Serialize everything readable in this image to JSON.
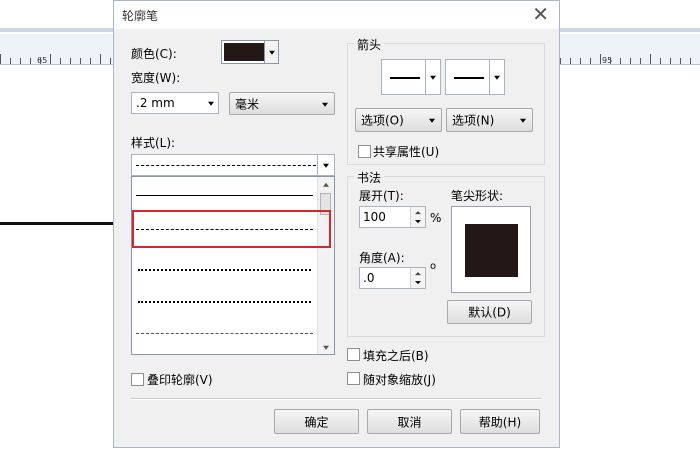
{
  "ruler": {
    "labels": [
      "65",
      "95"
    ]
  },
  "dialog": {
    "title": "轮廓笔",
    "close_glyph": "✕",
    "color_label": "颜色(C):",
    "color_value": "#231816",
    "width_label": "宽度(W):",
    "width_value": ".2 mm",
    "unit_value": "毫米",
    "style_label": "样式(L):",
    "overprint_label": "叠印轮廓(V)",
    "arrows": {
      "group_title": "箭头",
      "options_left": "选项(O)",
      "options_right": "选项(N)",
      "share_label": "共享属性(U)"
    },
    "calligraphy": {
      "group_title": "书法",
      "stretch_label": "展开(T):",
      "stretch_value": "100",
      "stretch_unit": "%",
      "angle_label": "角度(A):",
      "angle_value": ".0",
      "angle_unit": "o",
      "nib_label": "笔尖形状:",
      "default_button": "默认(D)"
    },
    "fill_behind_label": "填充之后(B)",
    "scale_label": "随对象缩放(J)",
    "buttons": {
      "ok": "确定",
      "cancel": "取消",
      "help": "帮助(H)"
    },
    "accent_color": "#d9262e"
  }
}
